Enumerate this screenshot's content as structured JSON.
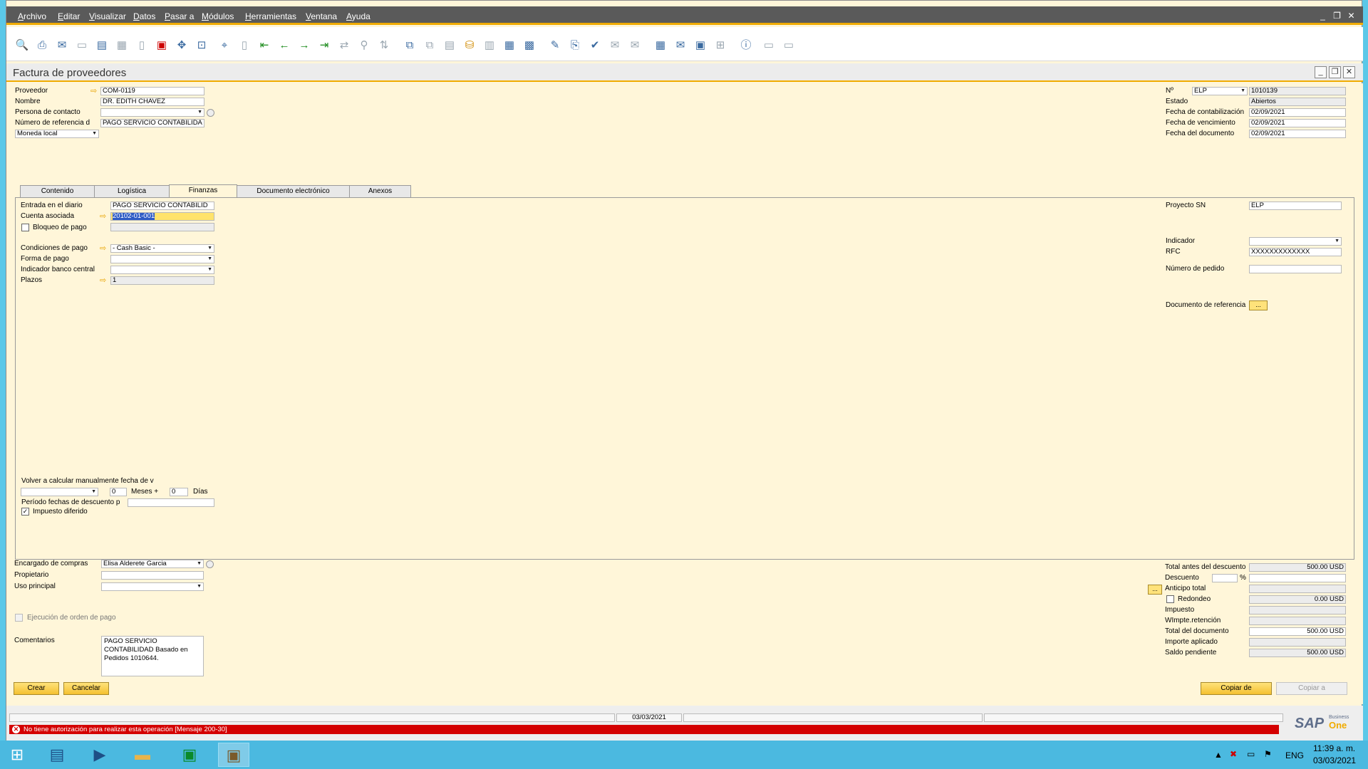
{
  "menu": [
    "Archivo",
    "Editar",
    "Visualizar",
    "Datos",
    "Pasar a",
    "Módulos",
    "Herramientas",
    "Ventana",
    "Ayuda"
  ],
  "window_controls": {
    "minimize": "_",
    "restore": "❐",
    "close": "✕"
  },
  "document": {
    "title": "Factura de proveedores"
  },
  "header_left": {
    "proveedor_label": "Proveedor",
    "proveedor_value": "COM-0119",
    "nombre_label": "Nombre",
    "nombre_value": "DR. EDITH CHAVEZ",
    "contacto_label": "Persona de contacto",
    "contacto_value": "",
    "referencia_label": "Número de referencia d",
    "referencia_value": "PAGO SERVICIO CONTABILIDA",
    "moneda_value": "Moneda local"
  },
  "header_right": {
    "no_label": "Nº",
    "serie_value": "ELP",
    "no_value": "1010139",
    "estado_label": "Estado",
    "estado_value": "Abiertos",
    "fecha_cont_label": "Fecha de contabilización",
    "fecha_cont_value": "02/09/2021",
    "fecha_venc_label": "Fecha de vencimiento",
    "fecha_venc_value": "02/09/2021",
    "fecha_doc_label": "Fecha del documento",
    "fecha_doc_value": "02/09/2021"
  },
  "tabs": [
    "Contenido",
    "Logística",
    "Finanzas",
    "Documento electrónico",
    "Anexos"
  ],
  "finanzas": {
    "entrada_label": "Entrada en el diario",
    "entrada_value": "PAGO SERVICIO CONTABILID",
    "cuenta_label": "Cuenta asociada",
    "cuenta_value": "20102-01-001",
    "bloqueo_label": "Bloqueo de pago",
    "condiciones_label": "Condiciones de pago",
    "condiciones_value": "- Cash Basic -",
    "forma_label": "Forma de pago",
    "forma_value": "",
    "banco_label": "Indicador banco central",
    "banco_value": "",
    "plazos_label": "Plazos",
    "plazos_value": "1",
    "recalc_label": "Volver a calcular manualmente fecha de v",
    "meses_value": "0",
    "meses_label": "Meses +",
    "dias_value": "0",
    "dias_label": "Días",
    "periodo_label": "Período fechas de descuento p",
    "impuesto_label": "Impuesto diferido",
    "proyecto_label": "Proyecto SN",
    "proyecto_value": "ELP",
    "indicador_label": "Indicador",
    "indicador_value": "",
    "rfc_label": "RFC",
    "rfc_value": "XXXXXXXXXXXXX",
    "pedido_label": "Número de pedido",
    "pedido_value": "",
    "docref_label": "Documento de referencia",
    "docref_btn": "..."
  },
  "footer_left": {
    "encargado_label": "Encargado de compras",
    "encargado_value": "Elisa Alderete Garcia",
    "propietario_label": "Propietario",
    "propietario_value": "",
    "uso_label": "Uso principal",
    "uso_value": "",
    "ejecucion_label": "Ejecución de orden de pago",
    "comentarios_label": "Comentarios",
    "comentarios_value": "PAGO SERVICIO CONTABILIDAD Basado en Pedidos 1010644."
  },
  "totals": {
    "antes_label": "Total antes del descuento",
    "antes_value": "500.00 USD",
    "descuento_label": "Descuento",
    "descuento_pct": "%",
    "anticipo_btn": "...",
    "anticipo_label": "Anticipo total",
    "redondeo_label": "Redondeo",
    "redondeo_value": "0.00 USD",
    "impuesto_label": "Impuesto",
    "wimpte_label": "WImpte.retención",
    "total_label": "Total del documento",
    "total_value": "500.00 USD",
    "aplicado_label": "Importe aplicado",
    "saldo_label": "Saldo pendiente",
    "saldo_value": "500.00 USD"
  },
  "buttons": {
    "crear": "Crear",
    "cancelar": "Cancelar",
    "copiar_de": "Copiar de",
    "copiar_a": "Copiar a"
  },
  "status": {
    "date": "03/03/2021",
    "error": "No tiene autorización para realizar esta operación  [Mensaje 200-30]"
  },
  "logo": {
    "sap": "SAP",
    "business": "Business",
    "one": "One"
  },
  "taskbar": {
    "lang": "ENG",
    "time": "11:39 a. m.",
    "date": "03/03/2021"
  },
  "colors": {
    "accent": "#f0ab00",
    "form_bg": "#fff6d9",
    "error": "#d40000",
    "taskbar": "#4bb9e0"
  }
}
